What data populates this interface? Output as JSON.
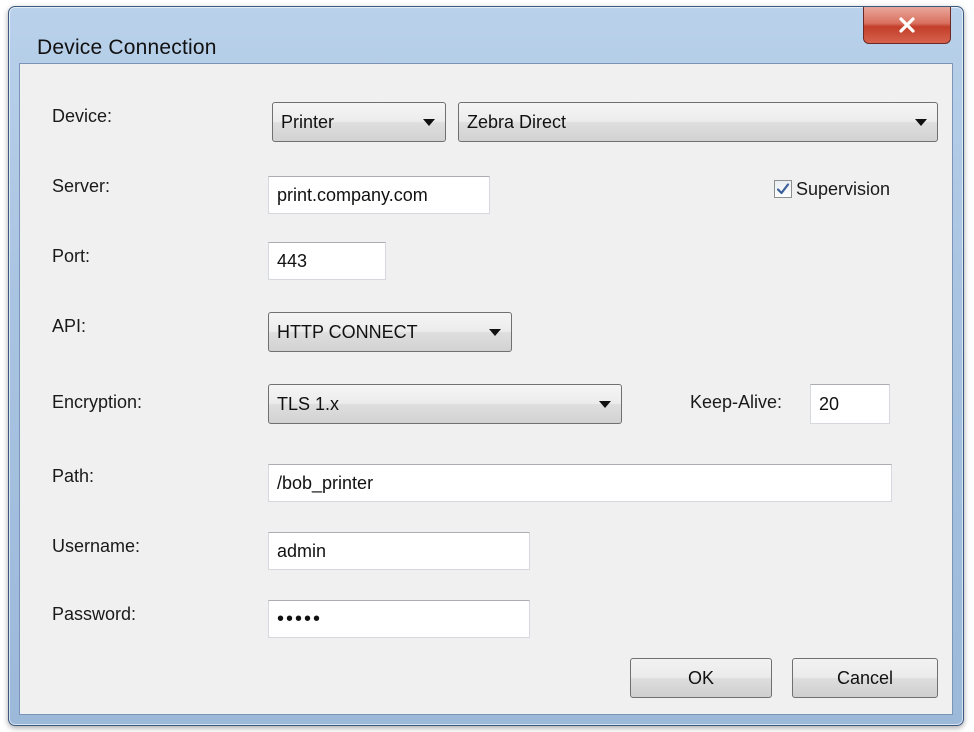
{
  "window": {
    "title": "Device Connection",
    "close_symbol": "×"
  },
  "labels": {
    "device": "Device:",
    "server": "Server:",
    "port": "Port:",
    "api": "API:",
    "encryption": "Encryption:",
    "keep_alive": "Keep-Alive:",
    "path": "Path:",
    "username": "Username:",
    "password": "Password:",
    "supervision": "Supervision"
  },
  "values": {
    "device_type": "Printer",
    "device_model": "Zebra Direct",
    "server": "print.company.com",
    "port": "443",
    "api": "HTTP CONNECT",
    "encryption": "TLS 1.x",
    "keep_alive": "20",
    "path": "/bob_printer",
    "username": "admin",
    "password_mask": "•••••",
    "supervision_checked": true
  },
  "buttons": {
    "ok": "OK",
    "cancel": "Cancel"
  },
  "icons": {
    "close": "close-icon",
    "dropdown": "chevron-down-icon",
    "checkmark": "checkmark-icon"
  },
  "colors": {
    "title_bar": "#b9d1ea",
    "close_button": "#c94a36",
    "dialog_bg": "#f0f0f0"
  }
}
